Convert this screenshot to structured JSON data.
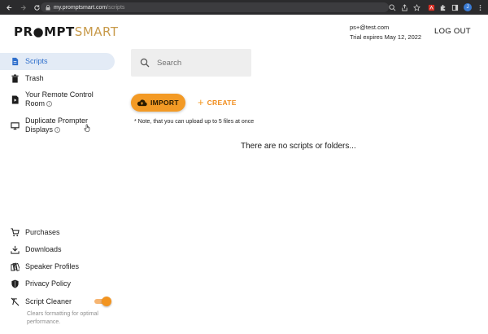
{
  "browser": {
    "url_host": "my.promptsmart.com",
    "url_path": "/scripts",
    "profile_initial": "J"
  },
  "header": {
    "logo_part1": "PR●MPT",
    "logo_part2": "SMART",
    "account_email": "ps+@test.com",
    "trial_text": "Trial expires May 12, 2022",
    "logout_label": "LOG OUT"
  },
  "sidebar": {
    "items": [
      {
        "label": "Scripts",
        "icon": "document-icon"
      },
      {
        "label": "Trash",
        "icon": "trash-icon"
      },
      {
        "label": "Your Remote Control",
        "label2": "Room",
        "icon": "remote-icon"
      },
      {
        "label": "Duplicate Prompter",
        "label2": "Displays",
        "icon": "monitor-icon"
      }
    ],
    "bottom_items": [
      {
        "label": "Purchases",
        "icon": "cart-icon"
      },
      {
        "label": "Downloads",
        "icon": "download-icon"
      },
      {
        "label": "Speaker Profiles",
        "icon": "speaker-profiles-icon"
      },
      {
        "label": "Privacy Policy",
        "icon": "shield-icon"
      },
      {
        "label": "Script Cleaner",
        "icon": "clear-format-icon"
      }
    ],
    "script_cleaner_desc_1": "Clears formatting for optimal",
    "script_cleaner_desc_2": "performance.",
    "script_cleaner_enabled": true
  },
  "main": {
    "search_placeholder": "Search",
    "import_label": "IMPORT",
    "create_label": "CREATE",
    "note": "* Note, that you can upload up to 5 files at once",
    "empty_message": "There are no scripts or folders..."
  },
  "colors": {
    "accent": "#f39a25",
    "active_bg": "#e3ebf6",
    "active_text": "#2f6fcc",
    "logo_gold": "#c89a4a"
  }
}
